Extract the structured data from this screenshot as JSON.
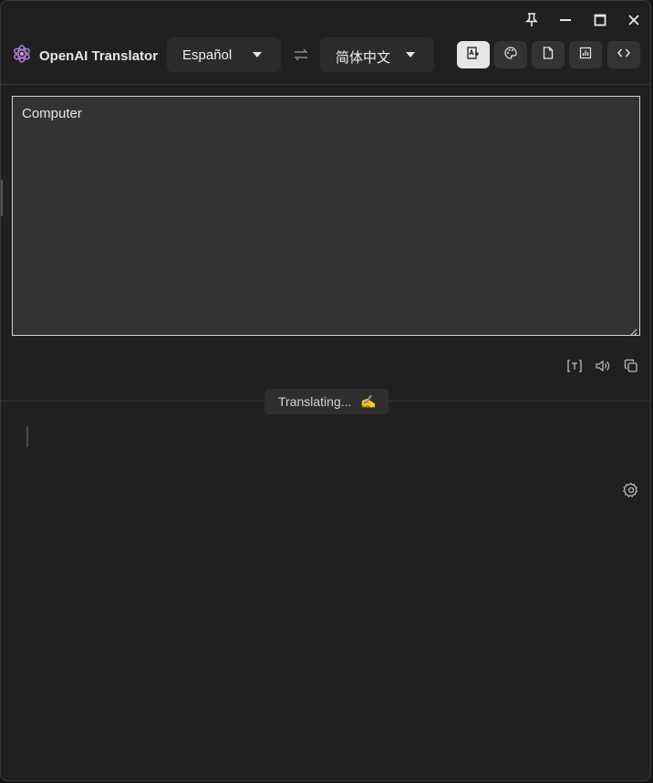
{
  "app": {
    "name": "OpenAI Translator"
  },
  "window_controls": {
    "icons": [
      "pin-icon",
      "minimize-icon",
      "maximize-icon",
      "close-icon"
    ]
  },
  "languages": {
    "source": "Español",
    "target": "简体中文"
  },
  "toolbar": {
    "icons": [
      "image-translate-icon",
      "palette-icon",
      "document-icon",
      "chart-icon",
      "code-icon"
    ],
    "active_index": 0
  },
  "source": {
    "text": "Computer"
  },
  "source_actions": {
    "icons": [
      "ocr-text-icon",
      "speaker-icon",
      "copy-icon"
    ]
  },
  "status": {
    "text": "Translating...",
    "emoji": "✍️"
  },
  "colors": {
    "background": "#202020",
    "panel": "#333333",
    "select_bg": "#2b2b2b",
    "active_button": "#e6e6e6",
    "text": "#e6e6e6"
  }
}
